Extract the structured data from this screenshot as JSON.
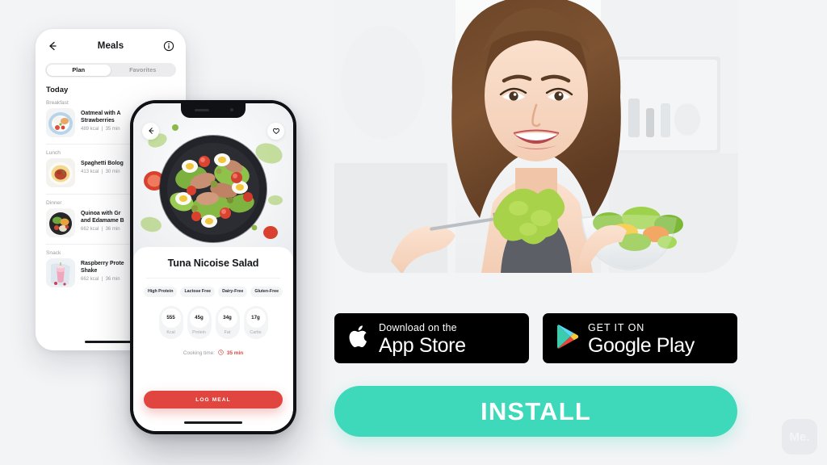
{
  "background_color": "#f3f4f6",
  "meals_phone": {
    "back_icon": "back-arrow-icon",
    "title": "Meals",
    "info_icon": "info-icon",
    "tabs": [
      {
        "label": "Plan",
        "active": true
      },
      {
        "label": "Favorites",
        "active": false
      }
    ],
    "day_label": "Today",
    "sections": [
      {
        "label": "Breakfast",
        "name": "Oatmeal with A… Strawberries",
        "name_line1": "Oatmeal with A",
        "name_line2": "Strawberries",
        "kcal": "489 kcal",
        "time": "35 min"
      },
      {
        "label": "Lunch",
        "name": "Spaghetti Bolog…",
        "name_line1": "Spaghetti Bolog",
        "name_line2": "",
        "kcal": "413 kcal",
        "time": "30 min"
      },
      {
        "label": "Dinner",
        "name": "Quinoa with Gr… and Edamame B…",
        "name_line1": "Quinoa with Gr",
        "name_line2": "and Edamame B",
        "kcal": "662 kcal",
        "time": "36 min"
      },
      {
        "label": "Snack",
        "name": "Raspberry Prote… Shake",
        "name_line1": "Raspberry Prote",
        "name_line2": "Shake",
        "kcal": "662 kcal",
        "time": "36 min"
      }
    ]
  },
  "recipe_phone": {
    "back_icon": "back-arrow-icon",
    "favorite_icon": "heart-icon",
    "dish_name": "Tuna Nicoise Salad",
    "tags": [
      "High Protein",
      "Lactose Free",
      "Dairy-Free",
      "Gluten-Free"
    ],
    "nutrition": [
      {
        "value": "555",
        "label": "Kcal"
      },
      {
        "value": "45g",
        "label": "Protein"
      },
      {
        "value": "34g",
        "label": "Fat"
      },
      {
        "value": "17g",
        "label": "Carbs"
      }
    ],
    "cooking_time_label": "Cooking time:",
    "cooking_time_icon": "clock-icon",
    "cooking_time_value": "35 min",
    "cta_label": "LOG MEAL",
    "cta_color": "#e0453f"
  },
  "hero": {
    "alt": "smiling-woman-eating-salad"
  },
  "badges": {
    "ios": {
      "icon": "apple-icon",
      "line1": "Download on the",
      "line2": "App Store"
    },
    "play": {
      "icon": "google-play-icon",
      "line1": "GET IT ON",
      "line2": "Google Play"
    }
  },
  "install_button": {
    "label": "INSTALL",
    "color": "#3ed9bb"
  },
  "watermark": {
    "label": "Me."
  }
}
